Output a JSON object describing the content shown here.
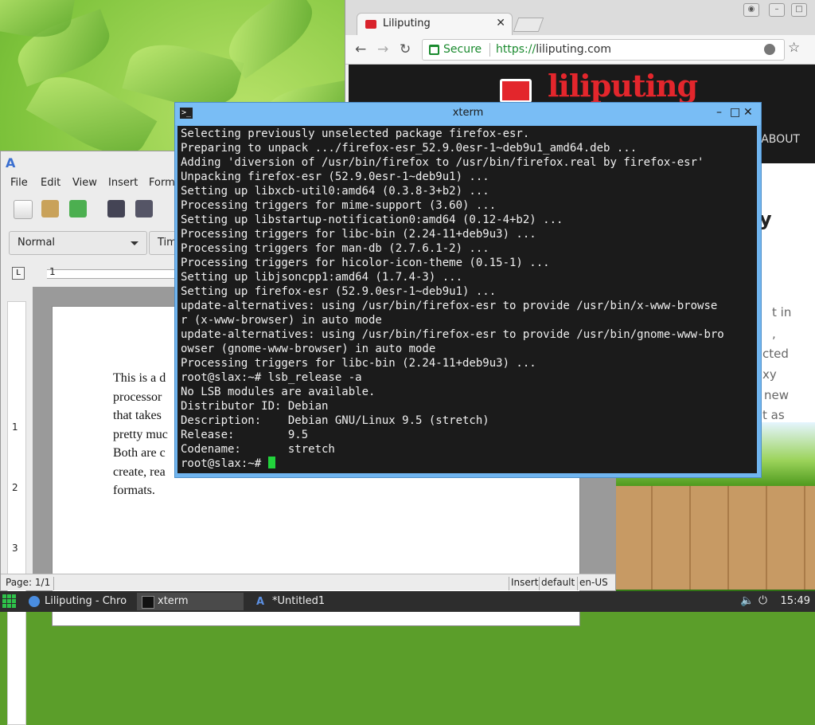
{
  "chrome": {
    "tab_title": "Liliputing",
    "tab_close": "✕",
    "secure_label": "Secure",
    "url_scheme": "https://",
    "url_host": "liliputing.com",
    "site_logo": "liliputing",
    "nav_about": "ABOUT",
    "frag_y": "y",
    "frag_1": "t in",
    "frag_2": ",",
    "frag_3": "cted",
    "frag_4": "xy",
    "frag_5": "new",
    "frag_6": "t as"
  },
  "abiword": {
    "menu": [
      "File",
      "Edit",
      "View",
      "Insert",
      "Form"
    ],
    "style": "Normal",
    "font": "Tim",
    "ruler_left": "1",
    "vruler_numbers": [
      "1",
      "2",
      "3"
    ],
    "doc_text": "This is a d\nprocessor\nthat takes\npretty muc\nBoth are c\ncreate, rea\nformats.",
    "status_page": "Page: 1/1",
    "status_insert": "Insert",
    "status_default": "default",
    "status_lang": "en-US"
  },
  "xterm": {
    "title": "xterm",
    "lines": "Selecting previously unselected package firefox-esr.\nPreparing to unpack .../firefox-esr_52.9.0esr-1~deb9u1_amd64.deb ...\nAdding 'diversion of /usr/bin/firefox to /usr/bin/firefox.real by firefox-esr'\nUnpacking firefox-esr (52.9.0esr-1~deb9u1) ...\nSetting up libxcb-util0:amd64 (0.3.8-3+b2) ...\nProcessing triggers for mime-support (3.60) ...\nSetting up libstartup-notification0:amd64 (0.12-4+b2) ...\nProcessing triggers for libc-bin (2.24-11+deb9u3) ...\nProcessing triggers for man-db (2.7.6.1-2) ...\nProcessing triggers for hicolor-icon-theme (0.15-1) ...\nSetting up libjsoncpp1:amd64 (1.7.4-3) ...\nSetting up firefox-esr (52.9.0esr-1~deb9u1) ...\nupdate-alternatives: using /usr/bin/firefox-esr to provide /usr/bin/x-www-browse\nr (x-www-browser) in auto mode\nupdate-alternatives: using /usr/bin/firefox-esr to provide /usr/bin/gnome-www-bro\nowser (gnome-www-browser) in auto mode\nProcessing triggers for libc-bin (2.24-11+deb9u3) ...\nroot@slax:~# lsb_release -a\nNo LSB modules are available.\nDistributor ID: Debian\nDescription:    Debian GNU/Linux 9.5 (stretch)\nRelease:        9.5\nCodename:       stretch",
    "prompt": "root@slax:~# "
  },
  "taskbar": {
    "tasks": [
      "Liliputing - Chro",
      "xterm",
      "*Untitled1"
    ],
    "clock": "15:49"
  },
  "colors": {
    "chrome_red": "#e3262c",
    "xterm_frame": "#79bdf5",
    "cursor_green": "#22d33c"
  }
}
